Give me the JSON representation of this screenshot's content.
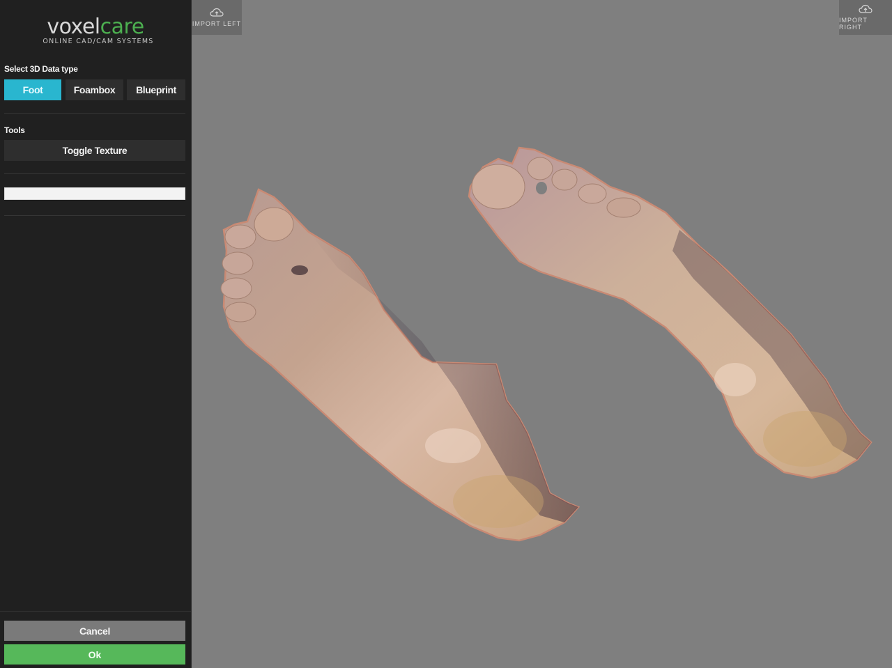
{
  "brand": {
    "name_part1": "voxel",
    "name_part2": "care",
    "tagline": "ONLINE CAD/CAM SYSTEMS",
    "colors": {
      "primary": "#d9d9d9",
      "accent": "#4caf50"
    }
  },
  "sidebar": {
    "data_type_label": "Select 3D Data type",
    "data_types": [
      {
        "label": "Foot",
        "active": true
      },
      {
        "label": "Foambox",
        "active": false
      },
      {
        "label": "Blueprint",
        "active": false
      }
    ],
    "tools_label": "Tools",
    "toggle_texture_label": "Toggle Texture",
    "name_input": {
      "value": "",
      "placeholder": ""
    },
    "cancel_label": "Cancel",
    "ok_label": "Ok"
  },
  "viewport": {
    "import_left_label": "IMPORT LEFT",
    "import_right_label": "IMPORT RIGHT",
    "import_icon": "cloud-upload-icon",
    "background_color": "#7f7f7f"
  },
  "colors": {
    "active_tab": "#29b6cf",
    "ok_button": "#56b85a",
    "cancel_button": "#7a7a7a",
    "sidebar_bg": "#202020"
  }
}
